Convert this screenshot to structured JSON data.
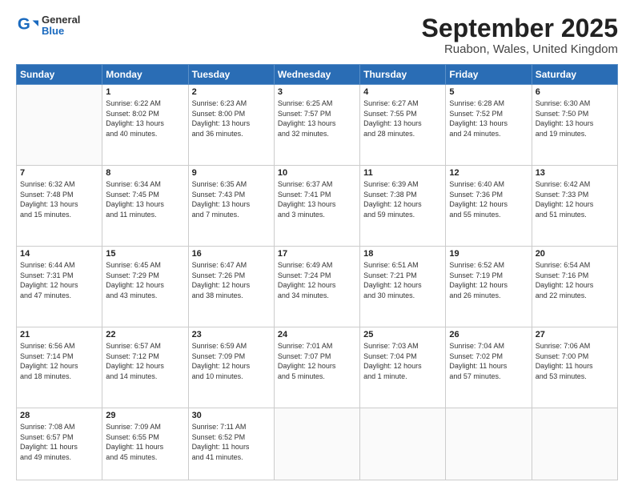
{
  "header": {
    "logo": {
      "general": "General",
      "blue": "Blue"
    },
    "title": "September 2025",
    "location": "Ruabon, Wales, United Kingdom"
  },
  "weekdays": [
    "Sunday",
    "Monday",
    "Tuesday",
    "Wednesday",
    "Thursday",
    "Friday",
    "Saturday"
  ],
  "weeks": [
    [
      {
        "day": "",
        "info": ""
      },
      {
        "day": "1",
        "info": "Sunrise: 6:22 AM\nSunset: 8:02 PM\nDaylight: 13 hours\nand 40 minutes."
      },
      {
        "day": "2",
        "info": "Sunrise: 6:23 AM\nSunset: 8:00 PM\nDaylight: 13 hours\nand 36 minutes."
      },
      {
        "day": "3",
        "info": "Sunrise: 6:25 AM\nSunset: 7:57 PM\nDaylight: 13 hours\nand 32 minutes."
      },
      {
        "day": "4",
        "info": "Sunrise: 6:27 AM\nSunset: 7:55 PM\nDaylight: 13 hours\nand 28 minutes."
      },
      {
        "day": "5",
        "info": "Sunrise: 6:28 AM\nSunset: 7:52 PM\nDaylight: 13 hours\nand 24 minutes."
      },
      {
        "day": "6",
        "info": "Sunrise: 6:30 AM\nSunset: 7:50 PM\nDaylight: 13 hours\nand 19 minutes."
      }
    ],
    [
      {
        "day": "7",
        "info": "Sunrise: 6:32 AM\nSunset: 7:48 PM\nDaylight: 13 hours\nand 15 minutes."
      },
      {
        "day": "8",
        "info": "Sunrise: 6:34 AM\nSunset: 7:45 PM\nDaylight: 13 hours\nand 11 minutes."
      },
      {
        "day": "9",
        "info": "Sunrise: 6:35 AM\nSunset: 7:43 PM\nDaylight: 13 hours\nand 7 minutes."
      },
      {
        "day": "10",
        "info": "Sunrise: 6:37 AM\nSunset: 7:41 PM\nDaylight: 13 hours\nand 3 minutes."
      },
      {
        "day": "11",
        "info": "Sunrise: 6:39 AM\nSunset: 7:38 PM\nDaylight: 12 hours\nand 59 minutes."
      },
      {
        "day": "12",
        "info": "Sunrise: 6:40 AM\nSunset: 7:36 PM\nDaylight: 12 hours\nand 55 minutes."
      },
      {
        "day": "13",
        "info": "Sunrise: 6:42 AM\nSunset: 7:33 PM\nDaylight: 12 hours\nand 51 minutes."
      }
    ],
    [
      {
        "day": "14",
        "info": "Sunrise: 6:44 AM\nSunset: 7:31 PM\nDaylight: 12 hours\nand 47 minutes."
      },
      {
        "day": "15",
        "info": "Sunrise: 6:45 AM\nSunset: 7:29 PM\nDaylight: 12 hours\nand 43 minutes."
      },
      {
        "day": "16",
        "info": "Sunrise: 6:47 AM\nSunset: 7:26 PM\nDaylight: 12 hours\nand 38 minutes."
      },
      {
        "day": "17",
        "info": "Sunrise: 6:49 AM\nSunset: 7:24 PM\nDaylight: 12 hours\nand 34 minutes."
      },
      {
        "day": "18",
        "info": "Sunrise: 6:51 AM\nSunset: 7:21 PM\nDaylight: 12 hours\nand 30 minutes."
      },
      {
        "day": "19",
        "info": "Sunrise: 6:52 AM\nSunset: 7:19 PM\nDaylight: 12 hours\nand 26 minutes."
      },
      {
        "day": "20",
        "info": "Sunrise: 6:54 AM\nSunset: 7:16 PM\nDaylight: 12 hours\nand 22 minutes."
      }
    ],
    [
      {
        "day": "21",
        "info": "Sunrise: 6:56 AM\nSunset: 7:14 PM\nDaylight: 12 hours\nand 18 minutes."
      },
      {
        "day": "22",
        "info": "Sunrise: 6:57 AM\nSunset: 7:12 PM\nDaylight: 12 hours\nand 14 minutes."
      },
      {
        "day": "23",
        "info": "Sunrise: 6:59 AM\nSunset: 7:09 PM\nDaylight: 12 hours\nand 10 minutes."
      },
      {
        "day": "24",
        "info": "Sunrise: 7:01 AM\nSunset: 7:07 PM\nDaylight: 12 hours\nand 5 minutes."
      },
      {
        "day": "25",
        "info": "Sunrise: 7:03 AM\nSunset: 7:04 PM\nDaylight: 12 hours\nand 1 minute."
      },
      {
        "day": "26",
        "info": "Sunrise: 7:04 AM\nSunset: 7:02 PM\nDaylight: 11 hours\nand 57 minutes."
      },
      {
        "day": "27",
        "info": "Sunrise: 7:06 AM\nSunset: 7:00 PM\nDaylight: 11 hours\nand 53 minutes."
      }
    ],
    [
      {
        "day": "28",
        "info": "Sunrise: 7:08 AM\nSunset: 6:57 PM\nDaylight: 11 hours\nand 49 minutes."
      },
      {
        "day": "29",
        "info": "Sunrise: 7:09 AM\nSunset: 6:55 PM\nDaylight: 11 hours\nand 45 minutes."
      },
      {
        "day": "30",
        "info": "Sunrise: 7:11 AM\nSunset: 6:52 PM\nDaylight: 11 hours\nand 41 minutes."
      },
      {
        "day": "",
        "info": ""
      },
      {
        "day": "",
        "info": ""
      },
      {
        "day": "",
        "info": ""
      },
      {
        "day": "",
        "info": ""
      }
    ]
  ]
}
